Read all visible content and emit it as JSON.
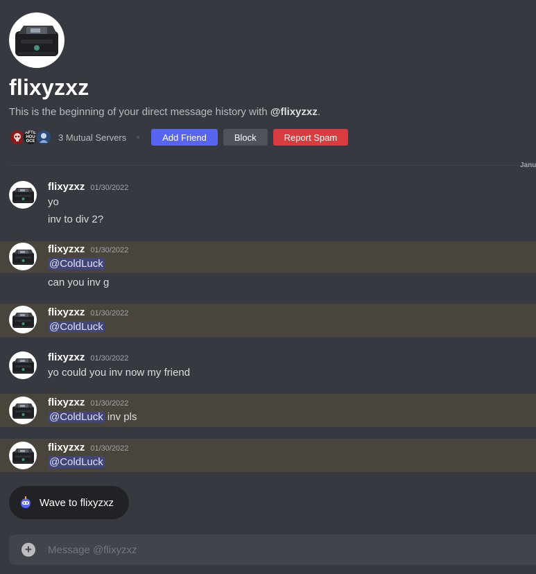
{
  "profile": {
    "name": "flixyzxz",
    "intro_prefix": "This is the beginning of your direct message history with ",
    "intro_handle": "@flixyzxz",
    "intro_suffix": ".",
    "mutual_servers": "3 Mutual Servers",
    "mutual_icon_labels": [
      "",
      "AFTE HOU OCE",
      ""
    ],
    "buttons": {
      "add_friend": "Add Friend",
      "block": "Block",
      "report_spam": "Report Spam"
    }
  },
  "divider_date": "Janu",
  "messages": [
    {
      "author": "flixyzxz",
      "timestamp": "01/30/2022",
      "lines": [
        "yo",
        "inv to div 2?"
      ]
    },
    {
      "author": "flixyzxz",
      "timestamp": "01/30/2022",
      "mention": "@ColdLuck",
      "lines": [
        "can you inv g"
      ]
    },
    {
      "author": "flixyzxz",
      "timestamp": "01/30/2022",
      "mention": "@ColdLuck"
    },
    {
      "author": "flixyzxz",
      "timestamp": "01/30/2022",
      "lines": [
        "yo could you inv now my friend"
      ]
    },
    {
      "author": "flixyzxz",
      "timestamp": "01/30/2022",
      "mention": "@ColdLuck",
      "mention_suffix": " inv pls"
    },
    {
      "author": "flixyzxz",
      "timestamp": "01/30/2022",
      "mention": "@ColdLuck"
    }
  ],
  "wave_button": "Wave to flixyzxz",
  "composer": {
    "placeholder": "Message @flixyzxz"
  },
  "colors": {
    "background": "#36393f",
    "mention_highlight": "#49443c",
    "mention_tag": "#414675",
    "blurple": "#5865f2",
    "danger": "#d83c3e"
  }
}
